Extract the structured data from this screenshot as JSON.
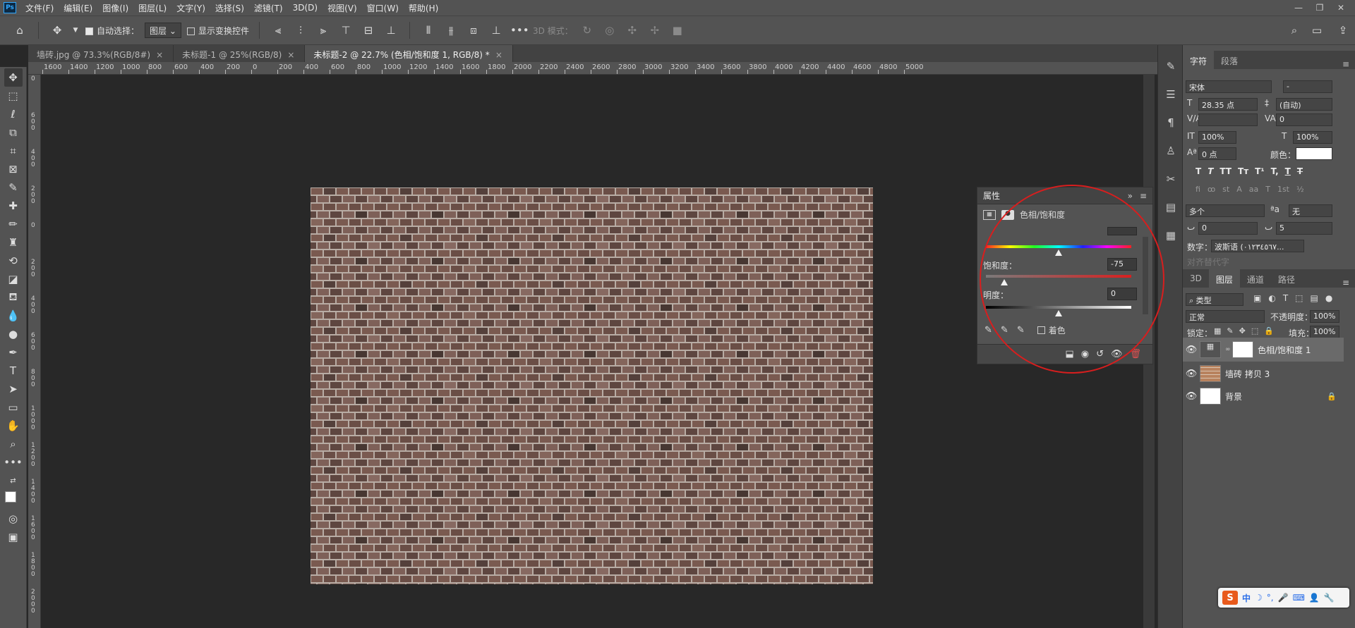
{
  "app": {
    "logo": "Ps"
  },
  "menu": [
    "文件(F)",
    "编辑(E)",
    "图像(I)",
    "图层(L)",
    "文字(Y)",
    "选择(S)",
    "滤镜(T)",
    "3D(D)",
    "视图(V)",
    "窗口(W)",
    "帮助(H)"
  ],
  "window_controls": [
    "—",
    "❐",
    "✕"
  ],
  "options_bar": {
    "auto_select_label": "自动选择：",
    "auto_select_value": "图层",
    "show_transform_label": "显示变换控件",
    "mode_3d_label": "3D 模式："
  },
  "tabs": [
    {
      "label": "墙砖.jpg @ 73.3%(RGB/8#)",
      "close": "×"
    },
    {
      "label": "未标题-1 @ 25%(RGB/8)",
      "close": "×"
    },
    {
      "label": "未标题-2 @ 22.7% (色相/饱和度 1, RGB/8) *",
      "close": "×",
      "active": true
    }
  ],
  "ruler_h": [
    "1600",
    "1400",
    "1200",
    "1000",
    "800",
    "600",
    "400",
    "200",
    "0",
    "200",
    "400",
    "600",
    "800",
    "1000",
    "1200",
    "1400",
    "1600",
    "1800",
    "2000",
    "2200",
    "2400",
    "2600",
    "2800",
    "3000",
    "3200",
    "3400",
    "3600",
    "3800",
    "4000",
    "4200",
    "4400",
    "4600",
    "4800",
    "5000"
  ],
  "ruler_v": [
    "0",
    "6 0 0",
    "4 0 0",
    "2 0 0",
    "0",
    "2 0 0",
    "4 0 0",
    "6 0 0",
    "8 0 0",
    "1 0 0 0",
    "1 2 0 0",
    "1 4 0 0",
    "1 6 0 0",
    "1 8 0 0",
    "2 0 0 0"
  ],
  "properties": {
    "title": "属性",
    "expand_icon": "»",
    "menu_icon": "≡",
    "adjustment_name": "色相/饱和度",
    "saturation_label": "饱和度：",
    "saturation_value": "-75",
    "saturation_level": -75,
    "lightness_label": "明度：",
    "lightness_value": "0",
    "lightness_level": 0,
    "colorize_label": "着色",
    "colorize_checked": false
  },
  "character": {
    "tab_character": "字符",
    "tab_paragraph": "段落",
    "font_family": "宋体",
    "font_style": "-",
    "font_size": "28.35 点",
    "leading": "(自动)",
    "kerning": "",
    "tracking": "0",
    "vertical_scale": "100%",
    "horizontal_scale": "100%",
    "baseline_shift": "0 点",
    "color_label": "颜色：",
    "language": "多个",
    "antialias": "无",
    "spacing_a": "0",
    "spacing_b": "5",
    "digits_label": "数字：",
    "digits_value": "波斯语 (٠١٢٣٤٥٦٧...",
    "alt_label": "对齐替代字",
    "style_buttons": [
      "T",
      "T",
      "TT",
      "Tт",
      "T¹",
      "T,",
      "T",
      "T"
    ],
    "extra_buttons": [
      "fi",
      "ꝏ",
      "st",
      "A",
      "aa",
      "T",
      "1st",
      "½"
    ]
  },
  "layers": {
    "tabs": [
      "3D",
      "图层",
      "通道",
      "路径"
    ],
    "filter_label": "类型",
    "blend_mode": "正常",
    "opacity_label": "不透明度：",
    "opacity_value": "100%",
    "lock_label": "锁定：",
    "fill_label": "填充：",
    "fill_value": "100%",
    "items": [
      {
        "name": "色相/饱和度 1",
        "selected": true
      },
      {
        "name": "墙砖 拷贝 3",
        "selected": false
      },
      {
        "name": "背景",
        "selected": false
      }
    ]
  },
  "ime": {
    "logo": "S",
    "mode": "中"
  },
  "colors": {
    "highlight": "#d81e1e",
    "panel": "#535353",
    "canvas_bg": "#282828"
  }
}
